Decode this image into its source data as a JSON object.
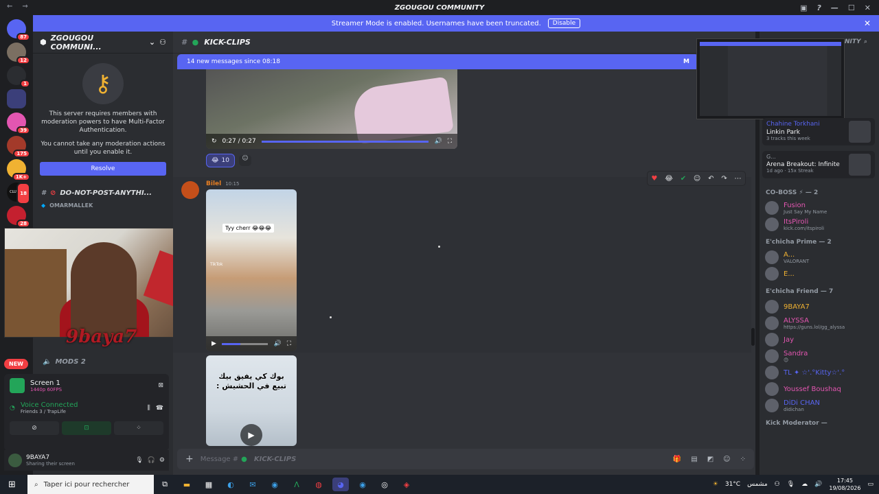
{
  "window": {
    "title": "ZGOUGOU COMMUNITY"
  },
  "banner": {
    "text": "Streamer Mode is enabled. Usernames have been truncated.",
    "button": "Disable"
  },
  "rail": {
    "badges": [
      "87",
      "12",
      "1",
      "39",
      "175",
      "1K+",
      "18",
      "28"
    ],
    "labels": [
      "CLUTCH"
    ]
  },
  "sidebar": {
    "server_name": "ZGOUGOU COMMUNI...",
    "mfa_text": "This server requires members with moderation powers to have Multi-Factor Authentication.",
    "mfa_sub": "You cannot take any moderation actions until you enable it.",
    "resolve": "Resolve",
    "channel_1": "DO-NOT-POST-ANYTHI...",
    "voice_user": "OMARMALLEK",
    "channel_2": "MODS 2"
  },
  "webcam": {
    "watermark": "9baya7"
  },
  "new_badge": "NEW",
  "voice": {
    "screen_title": "Screen 1",
    "screen_sub": "1440p 60FPS",
    "status": "Voice Connected",
    "location": "Friends 3 / TrapLife"
  },
  "user": {
    "name": "9BAYA7",
    "status": "Sharing their screen"
  },
  "channel": {
    "name": "KICK-CLIPS"
  },
  "new_messages": {
    "text": "14 new messages since 08:18",
    "mark": "M"
  },
  "video1": {
    "time": "0:27 / 0:27",
    "progress": 1.0
  },
  "reaction": {
    "emoji": "😂",
    "count": "10"
  },
  "message": {
    "author": "Bilel",
    "time": "10:15"
  },
  "video2": {
    "caption": "Tyy cherr 😂😂😂",
    "watermark": "TikTok",
    "progress": 0.4
  },
  "video3": {
    "caption": "بوك كي يفيق بيك تبيع في الحشيش :"
  },
  "composer": {
    "placeholder": "Message #",
    "channel": "KICK-CLIPS"
  },
  "members_panel": {
    "header_text": "NITY",
    "activities": [
      {
        "name": "Chahine Torkhani",
        "title": "Linkin Park",
        "sub": "3 tracks this week"
      },
      {
        "name": "G...",
        "title": "Arena Breakout: Infinite",
        "sub": "1d ago · 15x Streak"
      }
    ],
    "groups": [
      {
        "title": "CO-BOSS ⚡ — 2",
        "members": [
          {
            "name": "Fusion",
            "status": "Just Say My Name",
            "color": "#e356b1"
          },
          {
            "name": "ItsPiroli",
            "status": "kick.com/itspiroli",
            "color": "#e356b1"
          }
        ]
      },
      {
        "title": "E'chicha Prime — 2",
        "members": [
          {
            "name": "A...",
            "status": "VALORANT",
            "color": "#f0b232"
          },
          {
            "name": "E...",
            "status": "",
            "color": "#f0b232"
          }
        ]
      },
      {
        "title": "E'chicha Friend — 7",
        "members": [
          {
            "name": "9BAYA7",
            "status": "",
            "color": "#f0b232"
          },
          {
            "name": "ALYSSA",
            "status": "https://guns.lol/gg_alyssa",
            "color": "#e356b1"
          },
          {
            "name": "Jay",
            "status": "",
            "color": "#e356b1"
          },
          {
            "name": "Sandra",
            "status": "😊",
            "color": "#e356b1"
          },
          {
            "name": "TL ✦ ☆'.°Kitty☆'.°",
            "status": "",
            "color": "#5865f2"
          },
          {
            "name": "Youssef Boushaq",
            "status": "",
            "color": "#e356b1"
          },
          {
            "name": "DiDi CHAN",
            "status": "didichan",
            "color": "#5865f2"
          }
        ]
      },
      {
        "title": "Kick Moderator —",
        "members": []
      }
    ]
  },
  "taskbar": {
    "search_placeholder": "Taper ici pour rechercher",
    "weather": "31°C",
    "weather_label": "مشمس",
    "time": "17:45",
    "date": "19/08/2026"
  }
}
